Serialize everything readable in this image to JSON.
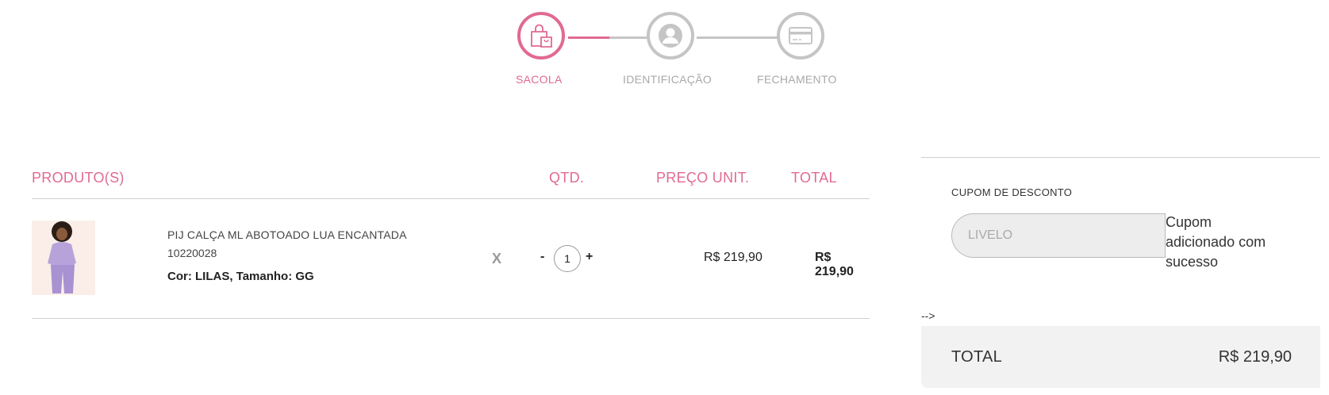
{
  "stepper": {
    "steps": [
      {
        "label": "SACOLA",
        "icon": "shopping-bag-icon",
        "active": true
      },
      {
        "label": "IDENTIFICAÇÃO",
        "icon": "user-icon",
        "active": false
      },
      {
        "label": "FECHAMENTO",
        "icon": "credit-card-icon",
        "active": false
      }
    ],
    "colors": {
      "active": "#e06a93",
      "inactive": "#c5c5c5"
    }
  },
  "cart": {
    "headers": {
      "product": "PRODUTO(S)",
      "qty": "QTD.",
      "unit_price": "PREÇO UNIT.",
      "total": "TOTAL"
    },
    "items": [
      {
        "name": "PIJ CALÇA ML ABOTOADO LUA ENCANTADA",
        "sku": "10220028",
        "attributes": "Cor: LILAS, Tamanho: GG",
        "remove_label": "X",
        "qty_minus": "-",
        "qty": "1",
        "qty_plus": "+",
        "unit_price": "R$ 219,90",
        "total": "R$ 219,90"
      }
    ]
  },
  "summary": {
    "coupon_title": "CUPOM DE DESCONTO",
    "coupon_value": "LIVELO",
    "coupon_message": "Cupom adicionado com sucesso",
    "stray_text": "-->",
    "total_label": "TOTAL",
    "total_value": "R$ 219,90"
  }
}
